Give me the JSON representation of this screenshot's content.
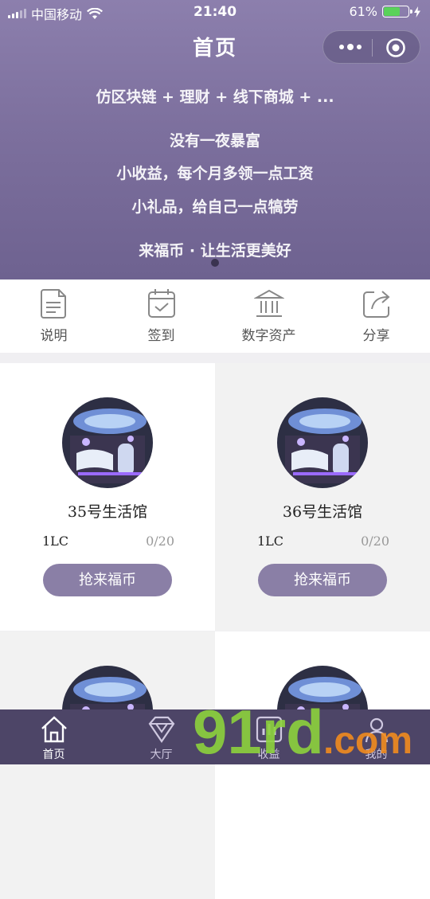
{
  "status_bar": {
    "carrier": "中国移动",
    "time": "21:40",
    "battery": "61%"
  },
  "header": {
    "title": "首页"
  },
  "banner": {
    "lines": [
      "仿区块链 + 理财 + 线下商城 + ...",
      "没有一夜暴富",
      "小收益，每个月多领一点工资",
      "小礼品，给自己一点犒劳",
      "来福币 · 让生活更美好"
    ]
  },
  "menu": [
    {
      "label": "说明",
      "icon": "document-icon"
    },
    {
      "label": "签到",
      "icon": "calendar-check-icon"
    },
    {
      "label": "数字资产",
      "icon": "bank-icon"
    },
    {
      "label": "分享",
      "icon": "share-icon"
    }
  ],
  "cards": [
    {
      "name": "35号生活馆",
      "price": "1LC",
      "count": "0/20",
      "button": "抢来福币"
    },
    {
      "name": "36号生活馆",
      "price": "1LC",
      "count": "0/20",
      "button": "抢来福币"
    },
    {
      "name": "",
      "price": "",
      "count": "",
      "button": ""
    },
    {
      "name": "",
      "price": "",
      "count": "",
      "button": ""
    }
  ],
  "tabbar": [
    {
      "label": "首页",
      "icon": "home-icon",
      "active": true
    },
    {
      "label": "大厅",
      "icon": "diamond-icon",
      "active": false
    },
    {
      "label": "收益",
      "icon": "chart-icon",
      "active": false
    },
    {
      "label": "我的",
      "icon": "user-icon",
      "active": false
    }
  ],
  "watermark": {
    "text": "91rd.com",
    "accent": "#8dd23c",
    "accent2": "#f28b1e"
  },
  "colors": {
    "primary": "#8a7fa6",
    "tabbar": "#4d4567",
    "hero": "#7d709e"
  }
}
